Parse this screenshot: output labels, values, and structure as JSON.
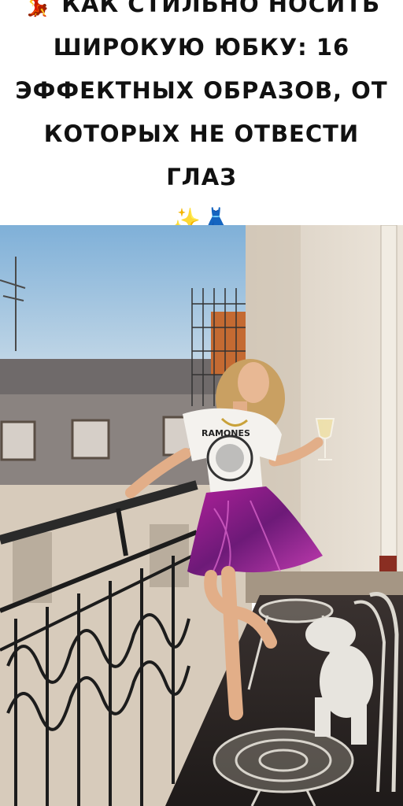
{
  "post": {
    "emoji_lead": "💃",
    "title": "Как стильно носить широкую юбку: 16 эффектных образов, от которых не отвести глаз",
    "emoji_trail": "✨👗"
  },
  "photo": {
    "tshirt_print": "RAMONES"
  }
}
